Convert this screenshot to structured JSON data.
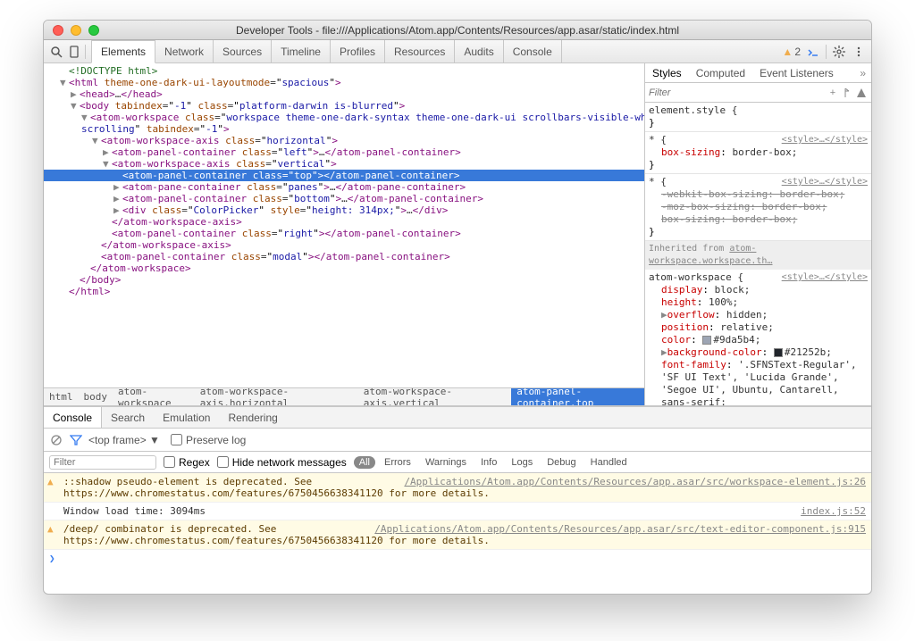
{
  "title": "Developer Tools - file:///Applications/Atom.app/Contents/Resources/app.asar/static/index.html",
  "toolbar": {
    "tabs": [
      "Elements",
      "Network",
      "Sources",
      "Timeline",
      "Profiles",
      "Resources",
      "Audits",
      "Console"
    ],
    "active_tab": "Elements",
    "error_count": 2
  },
  "dom": {
    "lines": [
      {
        "indent": 1,
        "arrow": "",
        "type": "comm",
        "text": "<!DOCTYPE html>"
      },
      {
        "indent": 1,
        "arrow": "▼",
        "type": "open",
        "tag": "html",
        "attrs": [
          [
            "theme-one-dark-ui-layoutmode",
            "spacious"
          ]
        ]
      },
      {
        "indent": 2,
        "arrow": "▶",
        "type": "inline",
        "tag": "head",
        "inner": "…"
      },
      {
        "indent": 2,
        "arrow": "▼",
        "type": "open",
        "tag": "body",
        "attrs": [
          [
            "tabindex",
            "-1"
          ],
          [
            "class",
            "platform-darwin is-blurred"
          ]
        ]
      },
      {
        "indent": 3,
        "arrow": "▼",
        "type": "open",
        "tag": "atom-workspace",
        "attrs": [
          [
            "class",
            "workspace theme-one-dark-syntax theme-one-dark-ui scrollbars-visible-when-scrolling"
          ],
          [
            "tabindex",
            "-1"
          ]
        ],
        "wrap": true
      },
      {
        "indent": 4,
        "arrow": "▼",
        "type": "open",
        "tag": "atom-workspace-axis",
        "attrs": [
          [
            "class",
            "horizontal"
          ]
        ]
      },
      {
        "indent": 5,
        "arrow": "▶",
        "type": "inline",
        "tag": "atom-panel-container",
        "attrs": [
          [
            "class",
            "left"
          ]
        ],
        "inner": "…"
      },
      {
        "indent": 5,
        "arrow": "▼",
        "type": "open",
        "tag": "atom-workspace-axis",
        "attrs": [
          [
            "class",
            "vertical"
          ]
        ]
      },
      {
        "indent": 6,
        "arrow": "",
        "type": "inline",
        "tag": "atom-panel-container",
        "attrs": [
          [
            "class",
            "top"
          ]
        ],
        "selected": true
      },
      {
        "indent": 6,
        "arrow": "▶",
        "type": "inline",
        "tag": "atom-pane-container",
        "attrs": [
          [
            "class",
            "panes"
          ]
        ],
        "inner": "…"
      },
      {
        "indent": 6,
        "arrow": "▶",
        "type": "inline",
        "tag": "atom-panel-container",
        "attrs": [
          [
            "class",
            "bottom"
          ]
        ],
        "inner": "…"
      },
      {
        "indent": 6,
        "arrow": "▶",
        "type": "inline",
        "tag": "div",
        "attrs": [
          [
            "class",
            "ColorPicker"
          ],
          [
            "style",
            "height: 314px;"
          ]
        ],
        "inner": "…"
      },
      {
        "indent": 5,
        "arrow": "",
        "type": "close",
        "tag": "atom-workspace-axis"
      },
      {
        "indent": 5,
        "arrow": "",
        "type": "inline",
        "tag": "atom-panel-container",
        "attrs": [
          [
            "class",
            "right"
          ]
        ]
      },
      {
        "indent": 4,
        "arrow": "",
        "type": "close",
        "tag": "atom-workspace-axis"
      },
      {
        "indent": 4,
        "arrow": "",
        "type": "inline",
        "tag": "atom-panel-container",
        "attrs": [
          [
            "class",
            "modal"
          ]
        ]
      },
      {
        "indent": 3,
        "arrow": "",
        "type": "close",
        "tag": "atom-workspace"
      },
      {
        "indent": 2,
        "arrow": "",
        "type": "close",
        "tag": "body"
      },
      {
        "indent": 1,
        "arrow": "",
        "type": "close",
        "tag": "html"
      }
    ]
  },
  "breadcrumbs": [
    "html",
    "body",
    "atom-workspace",
    "atom-workspace-axis.horizontal",
    "atom-workspace-axis.vertical",
    "atom-panel-container.top"
  ],
  "styles": {
    "tabs": [
      "Styles",
      "Computed",
      "Event Listeners"
    ],
    "active": "Styles",
    "filter_placeholder": "Filter",
    "rules": [
      {
        "selector": "element.style {",
        "link": "",
        "props": [],
        "close": "}"
      },
      {
        "selector": "* {",
        "link": "<style>…</style>",
        "props": [
          {
            "n": "box-sizing",
            "v": "border-box;"
          }
        ],
        "close": "}"
      },
      {
        "selector": "* {",
        "link": "<style>…</style>",
        "props": [
          {
            "n": "-webkit-box-sizing",
            "v": "border-box;",
            "strike": true
          },
          {
            "n": "-moz-box-sizing",
            "v": "border-box;",
            "strike": true
          },
          {
            "n": "box-sizing",
            "v": "border-box;",
            "strike": true
          }
        ],
        "close": "}"
      }
    ],
    "inherited_from": "atom-workspace.workspace.th…",
    "inherited_rule": {
      "selector": "atom-workspace {",
      "link": "<style>…</style>",
      "props": [
        {
          "n": "display",
          "v": "block;"
        },
        {
          "n": "height",
          "v": "100%;"
        },
        {
          "n": "overflow",
          "v": "hidden;",
          "hidden": true
        },
        {
          "n": "position",
          "v": "relative;"
        },
        {
          "n": "color",
          "v": "#9da5b4;",
          "swatch": "#9da5b4"
        },
        {
          "n": "background-color",
          "v": "#21252b;",
          "swatch": "#21252b",
          "hidden": true
        },
        {
          "n": "font-family",
          "v": "'.SFNSText-Regular', 'SF UI Text', 'Lucida Grande', 'Segoe UI', Ubuntu, Cantarell, sans-serif;"
        }
      ]
    }
  },
  "drawer": {
    "tabs": [
      "Console",
      "Search",
      "Emulation",
      "Rendering"
    ],
    "active": "Console",
    "frame_selector": "<top frame>",
    "preserve_log_label": "Preserve log",
    "filter_placeholder": "Filter",
    "regex_label": "Regex",
    "hide_network_label": "Hide network messages",
    "levels": [
      "All",
      "Errors",
      "Warnings",
      "Info",
      "Logs",
      "Debug",
      "Handled"
    ],
    "active_level": "All",
    "logs": [
      {
        "level": "warn",
        "loc": "/Applications/Atom.app/Contents/Resources/app.asar/src/workspace-element.js:26",
        "msg": "::shadow pseudo-element is deprecated. See https://www.chromestatus.com/features/6750456638341120 for more details."
      },
      {
        "level": "plain",
        "loc": "index.js:52",
        "msg": "Window load time: 3094ms"
      },
      {
        "level": "warn",
        "loc": "/Applications/Atom.app/Contents/Resources/app.asar/src/text-editor-component.js:915",
        "msg": "/deep/ combinator is deprecated. See https://www.chromestatus.com/features/6750456638341120 for more details."
      }
    ],
    "prompt": "❯"
  }
}
